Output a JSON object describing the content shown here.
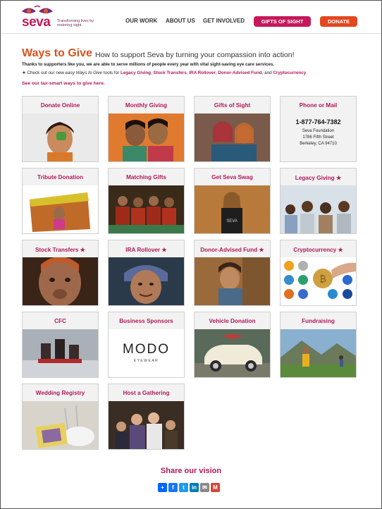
{
  "header": {
    "logo_text": "seva",
    "logo_tagline": "Transforming lives by restoring sight.",
    "nav": [
      "OUR WORK",
      "ABOUT US",
      "GET INVOLVED"
    ],
    "gifts_button": "GIFTS OF SIGHT",
    "donate_button": "DONATE"
  },
  "intro": {
    "title": "Ways to Give",
    "subtitle": "How to support Seva by turning your compassion into action!",
    "thanks": "Thanks to supporters like you, we are able to serve millions of people every year with vital sight-saving eye care services.",
    "star_text_1": "Check out our new ",
    "star_text_em": "easy Ways to Give",
    "star_text_2": " tools for ",
    "star_links": [
      "Legacy Giving",
      "Stock Transfers",
      "IRA Rollover",
      "Donor-Advised Fund"
    ],
    "star_text_and": ", and ",
    "star_last": "Cryptocurrency",
    "tax_link": "See our tax-smart ways to give here."
  },
  "cards": [
    {
      "label": "Donate Online"
    },
    {
      "label": "Monthly Giving"
    },
    {
      "label": "Gifts of Sight"
    },
    {
      "label": "Phone or Mail",
      "phone": "1-877-764-7382",
      "addr1": "Seva Foundation",
      "addr2": "1786 Fifth Street",
      "addr3": "Berkeley, CA 94710"
    },
    {
      "label": "Tribute Donation"
    },
    {
      "label": "Matching Gifts"
    },
    {
      "label": "Get Seva Swag"
    },
    {
      "label": "Legacy Giving ★"
    },
    {
      "label": "Stock Transfers ★"
    },
    {
      "label": "IRA Rollover ★"
    },
    {
      "label": "Donor-Advised Fund ★"
    },
    {
      "label": "Cryptocurrency ★"
    },
    {
      "label": "CFC"
    },
    {
      "label": "Business Sponsors",
      "logo_main": "MODO",
      "logo_sub": "EYEWEAR"
    },
    {
      "label": "Vehicle Donation"
    },
    {
      "label": "Fundraising"
    },
    {
      "label": "Wedding Registry"
    },
    {
      "label": "Host a Gathering"
    }
  ],
  "share": {
    "title": "Share our vision",
    "buttons": [
      "+",
      "f",
      "t",
      "in",
      "✉",
      "M"
    ]
  },
  "colors": {
    "brand_pink": "#b0175a",
    "donate_orange": "#e2481e",
    "gifts_pink": "#c4195a",
    "title_orange": "#d9531e"
  }
}
